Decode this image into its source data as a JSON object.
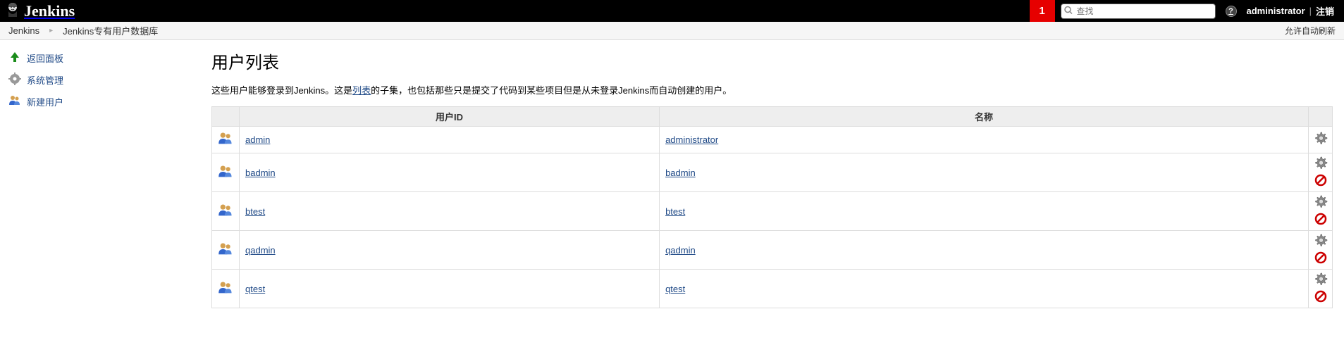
{
  "header": {
    "logo_text": "Jenkins",
    "notif_count": "1",
    "search_placeholder": "查找",
    "username": "administrator",
    "logout": "注销"
  },
  "breadcrumb": {
    "items": [
      "Jenkins",
      "Jenkins专有用户数据库"
    ],
    "auto_refresh": "允许自动刷新"
  },
  "sidebar": {
    "items": [
      {
        "label": "返回面板"
      },
      {
        "label": "系统管理"
      },
      {
        "label": "新建用户"
      }
    ]
  },
  "main": {
    "title": "用户列表",
    "desc_pre": "这些用户能够登录到Jenkins。这是",
    "desc_link": "列表",
    "desc_post": "的子集，也包括那些只是提交了代码到某些项目但是从未登录Jenkins而自动创建的用户。",
    "columns": {
      "id": "用户ID",
      "name": "名称"
    },
    "users": [
      {
        "id": "admin",
        "name": "administrator",
        "deletable": false
      },
      {
        "id": "badmin",
        "name": "badmin",
        "deletable": true
      },
      {
        "id": "btest",
        "name": "btest",
        "deletable": true
      },
      {
        "id": "qadmin",
        "name": "qadmin",
        "deletable": true
      },
      {
        "id": "qtest",
        "name": "qtest",
        "deletable": true
      }
    ]
  }
}
